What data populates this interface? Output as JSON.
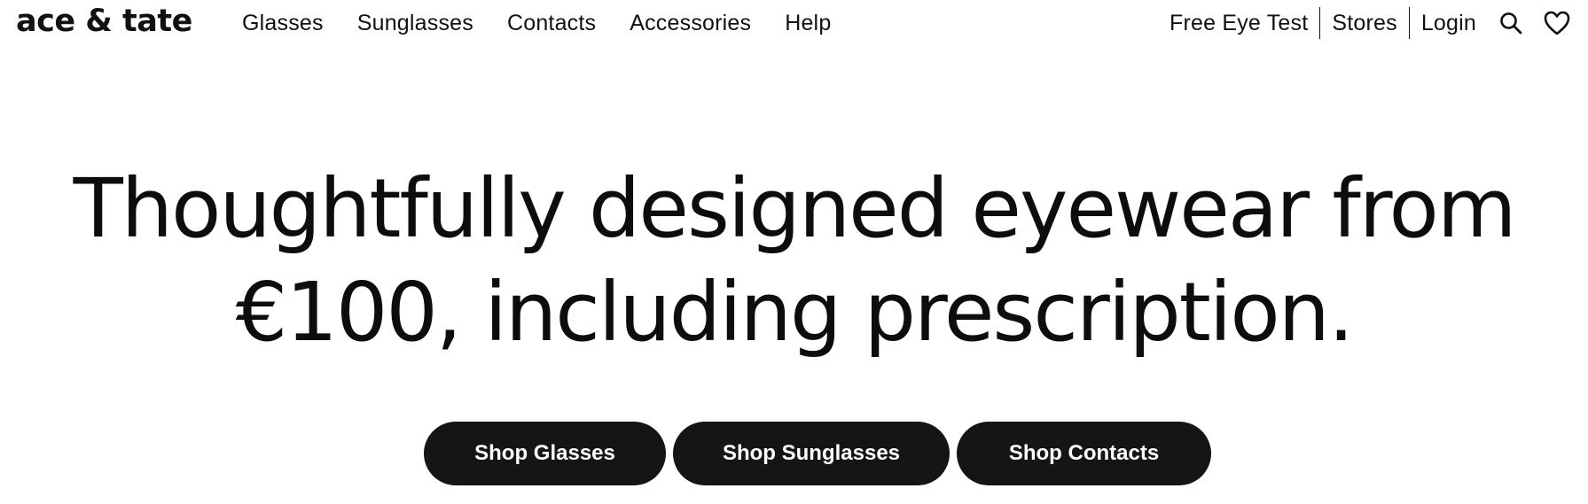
{
  "header": {
    "logo": "ace & tate",
    "nav": [
      {
        "label": "Glasses"
      },
      {
        "label": "Sunglasses"
      },
      {
        "label": "Contacts"
      },
      {
        "label": "Accessories"
      },
      {
        "label": "Help"
      }
    ],
    "utility": {
      "eye_test": "Free Eye Test",
      "stores": "Stores",
      "login": "Login"
    },
    "icons": {
      "search": "search-icon",
      "wishlist": "heart-icon"
    }
  },
  "hero": {
    "headline_line1": "Thoughtfully designed eyewear from",
    "headline_line2": "€100, including prescription.",
    "ctas": [
      {
        "label": "Shop Glasses"
      },
      {
        "label": "Shop Sunglasses"
      },
      {
        "label": "Shop Contacts"
      }
    ]
  },
  "colors": {
    "text": "#111111",
    "button_bg": "#151515",
    "button_text": "#ffffff",
    "background": "#ffffff"
  }
}
